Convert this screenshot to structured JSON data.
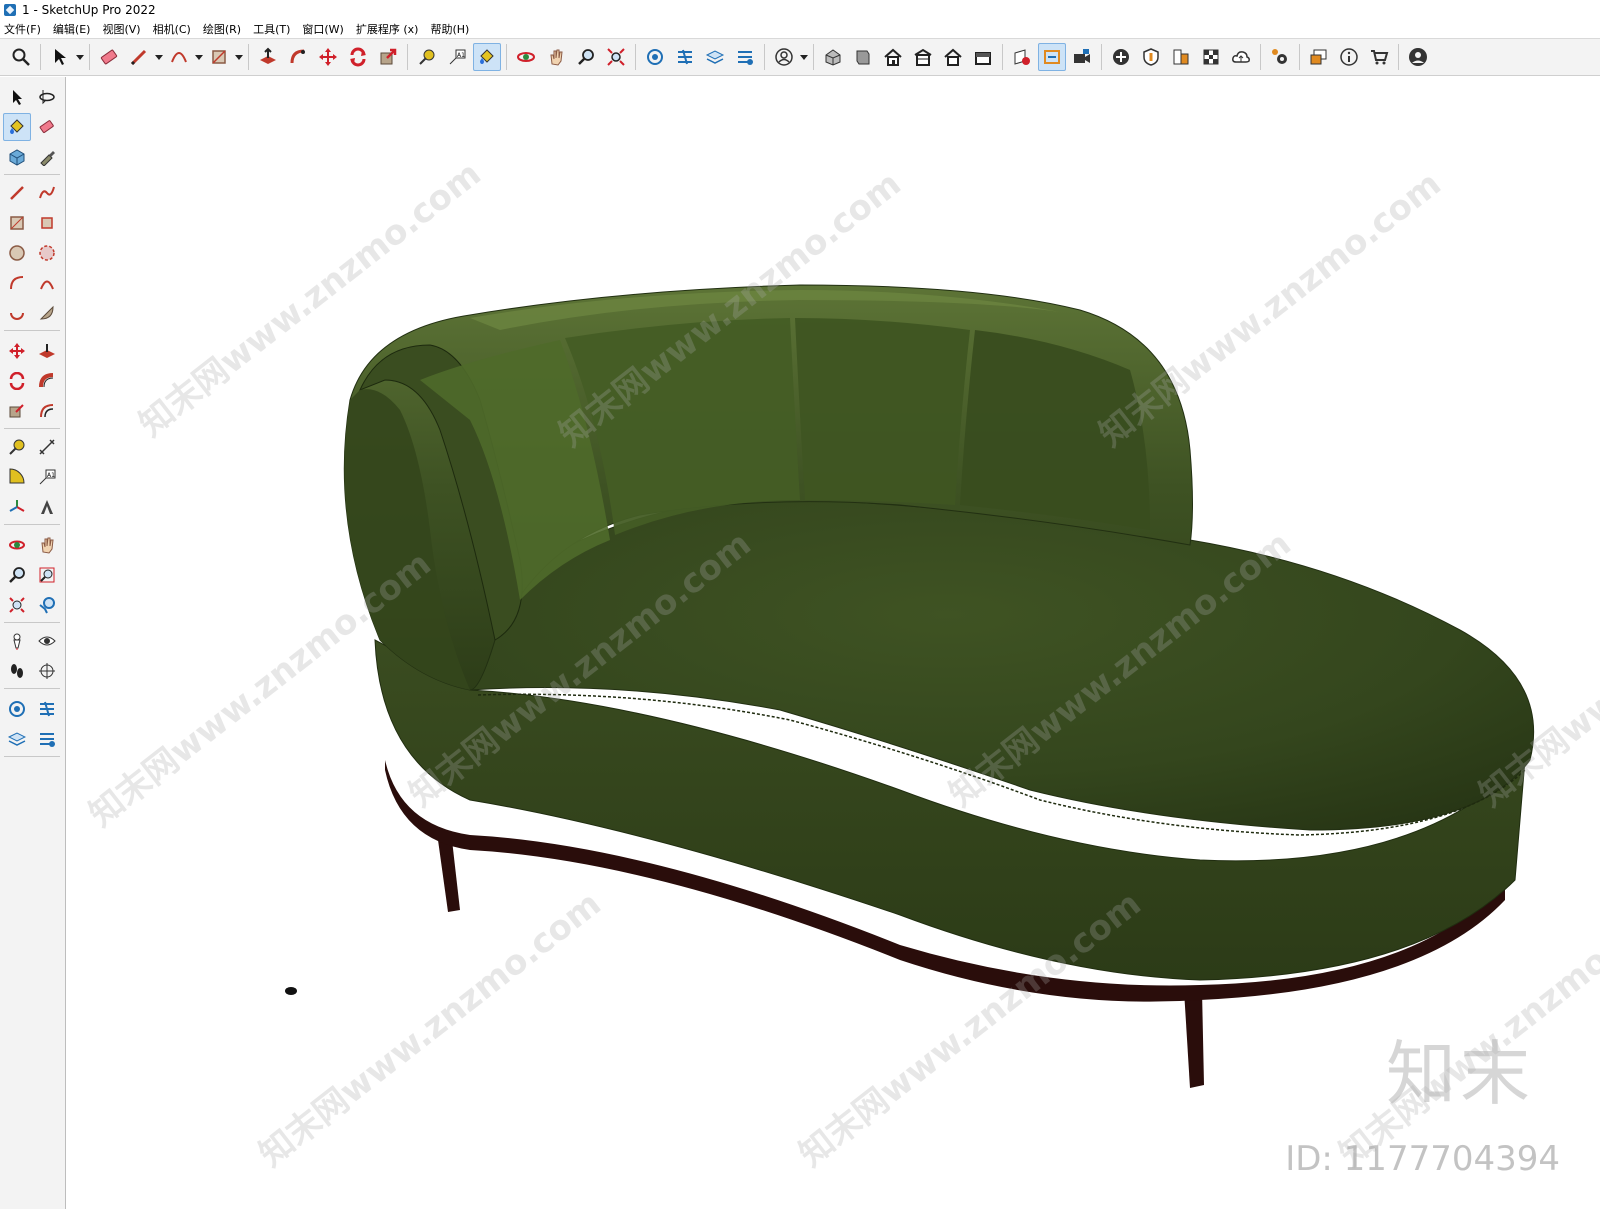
{
  "window": {
    "title": "1 - SketchUp Pro 2022"
  },
  "menubar": {
    "items": [
      {
        "label": "文件(F)"
      },
      {
        "label": "编辑(E)"
      },
      {
        "label": "视图(V)"
      },
      {
        "label": "相机(C)"
      },
      {
        "label": "绘图(R)"
      },
      {
        "label": "工具(T)"
      },
      {
        "label": "窗口(W)"
      },
      {
        "label": "扩展程序 (x)"
      },
      {
        "label": "帮助(H)"
      }
    ]
  },
  "toolbar": {
    "icons": [
      "search-icon",
      "select-icon",
      "eraser-icon",
      "pencil-icon",
      "arc-icon",
      "rectangle-icon",
      "push-pull-icon",
      "follow-me-icon",
      "move-icon",
      "rotate-icon",
      "scale-icon",
      "tape-measure-icon",
      "text-icon",
      "paint-bucket-icon",
      "orbit-icon",
      "pan-icon",
      "zoom-icon",
      "zoom-extents-icon",
      "warehouse-icon",
      "share-icon",
      "layers-icon",
      "extension-icon",
      "user-icon",
      "iso-view-icon",
      "top-view-icon",
      "front-view-icon",
      "right-view-icon",
      "back-view-icon",
      "left-view-icon",
      "sections-icon",
      "section-plane-icon",
      "camera-icon",
      "add-icon",
      "shield-icon",
      "styles-icon",
      "checker-icon",
      "cloud-icon",
      "settings-icon",
      "dialog-icon",
      "info-icon",
      "cart-icon",
      "account-icon"
    ]
  },
  "viewport": {
    "background": "#ffffff",
    "sofa_color": "#3d4f22",
    "leg_color": "#2a0d0b"
  },
  "watermark": {
    "text": "知末网www.znzmo.com",
    "logo": "知末",
    "id_label": "ID: 1177704394"
  }
}
